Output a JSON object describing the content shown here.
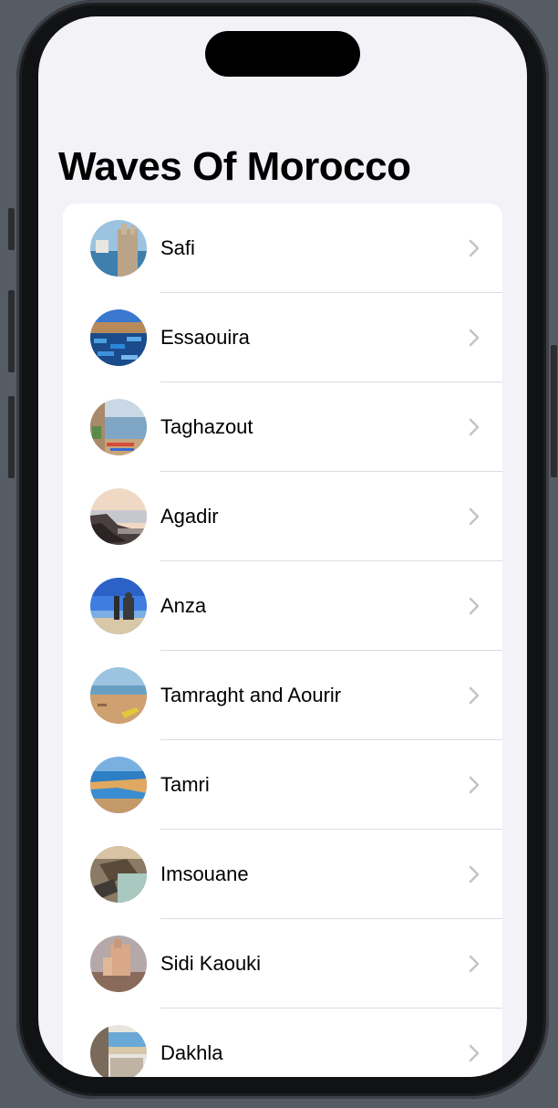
{
  "screen": {
    "title": "Waves Of Morocco"
  },
  "list": {
    "items": [
      {
        "label": "Safi",
        "icon": "chevron-right-icon"
      },
      {
        "label": "Essaouira",
        "icon": "chevron-right-icon"
      },
      {
        "label": "Taghazout",
        "icon": "chevron-right-icon"
      },
      {
        "label": "Agadir",
        "icon": "chevron-right-icon"
      },
      {
        "label": "Anza",
        "icon": "chevron-right-icon"
      },
      {
        "label": "Tamraght and Aourir",
        "icon": "chevron-right-icon"
      },
      {
        "label": "Tamri",
        "icon": "chevron-right-icon"
      },
      {
        "label": "Imsouane",
        "icon": "chevron-right-icon"
      },
      {
        "label": "Sidi Kaouki",
        "icon": "chevron-right-icon"
      },
      {
        "label": "Dakhla",
        "icon": "chevron-right-icon"
      }
    ]
  },
  "colors": {
    "background": "#f2f2f7",
    "card": "#ffffff",
    "chevron": "#c4c4c7",
    "separator": "#dcdce0"
  }
}
